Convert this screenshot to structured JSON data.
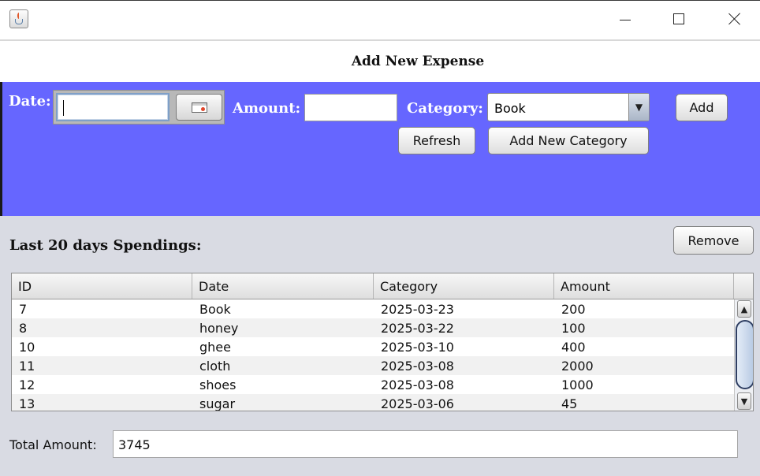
{
  "window": {
    "app_icon": "java-coffee-cup-icon",
    "controls": [
      "minimize-icon",
      "maximize-icon",
      "close-icon"
    ]
  },
  "header": {
    "title": "Add New Expense"
  },
  "form": {
    "date_label": "Date:",
    "date_value": "",
    "calendar_icon": "calendar-icon",
    "amount_label": "Amount:",
    "amount_value": "",
    "category_label": "Category:",
    "category_selected": "Book",
    "add_label": "Add",
    "refresh_label": "Refresh",
    "add_category_label": "Add New Category",
    "panel_color": "#6666ff"
  },
  "spendings": {
    "title": "Last 20 days Spendings:",
    "remove_label": "Remove",
    "columns": [
      "ID",
      "Date",
      "Category",
      "Amount"
    ],
    "rows": [
      [
        "7",
        "Book",
        "2025-03-23",
        "200"
      ],
      [
        "8",
        "honey",
        "2025-03-22",
        "100"
      ],
      [
        "10",
        "ghee",
        "2025-03-10",
        "400"
      ],
      [
        "11",
        "cloth",
        "2025-03-08",
        "2000"
      ],
      [
        "12",
        "shoes",
        "2025-03-08",
        "1000"
      ],
      [
        "13",
        "sugar",
        "2025-03-06",
        "45"
      ]
    ]
  },
  "total": {
    "label": "Total Amount:",
    "value": "3745"
  }
}
